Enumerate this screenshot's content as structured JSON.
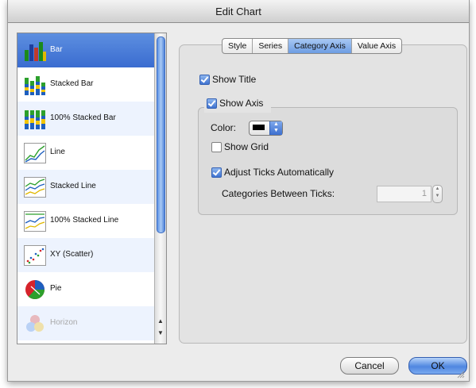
{
  "window": {
    "title": "Edit Chart"
  },
  "chart_types": [
    {
      "label": "Bar",
      "icon": "bar-chart-icon"
    },
    {
      "label": "Stacked Bar",
      "icon": "stacked-bar-chart-icon"
    },
    {
      "label": "100% Stacked Bar",
      "icon": "percent-stacked-bar-chart-icon"
    },
    {
      "label": "Line",
      "icon": "line-chart-icon"
    },
    {
      "label": "Stacked Line",
      "icon": "stacked-line-chart-icon"
    },
    {
      "label": "100% Stacked Line",
      "icon": "percent-stacked-line-chart-icon"
    },
    {
      "label": "XY (Scatter)",
      "icon": "scatter-chart-icon"
    },
    {
      "label": "Pie",
      "icon": "pie-chart-icon"
    },
    {
      "label": "Horizon",
      "icon": "horizon-chart-icon"
    }
  ],
  "selected_chart_type": "Bar",
  "tabs": [
    {
      "label": "Style"
    },
    {
      "label": "Series"
    },
    {
      "label": "Category Axis"
    },
    {
      "label": "Value Axis"
    }
  ],
  "active_tab": "Category Axis",
  "category_axis": {
    "show_title": {
      "label": "Show Title",
      "checked": true
    },
    "show_axis": {
      "label": "Show Axis",
      "checked": true
    },
    "color_label": "Color:",
    "color_value": "#000000",
    "show_grid": {
      "label": "Show Grid",
      "checked": false
    },
    "adjust_ticks": {
      "label": "Adjust Ticks Automatically",
      "checked": true
    },
    "categories_between_ticks_label": "Categories Between Ticks:",
    "categories_between_ticks_value": "1"
  },
  "buttons": {
    "cancel": "Cancel",
    "ok": "OK"
  },
  "colors": {
    "selection": "#3a6cd0",
    "accent": "#4f86e0"
  }
}
